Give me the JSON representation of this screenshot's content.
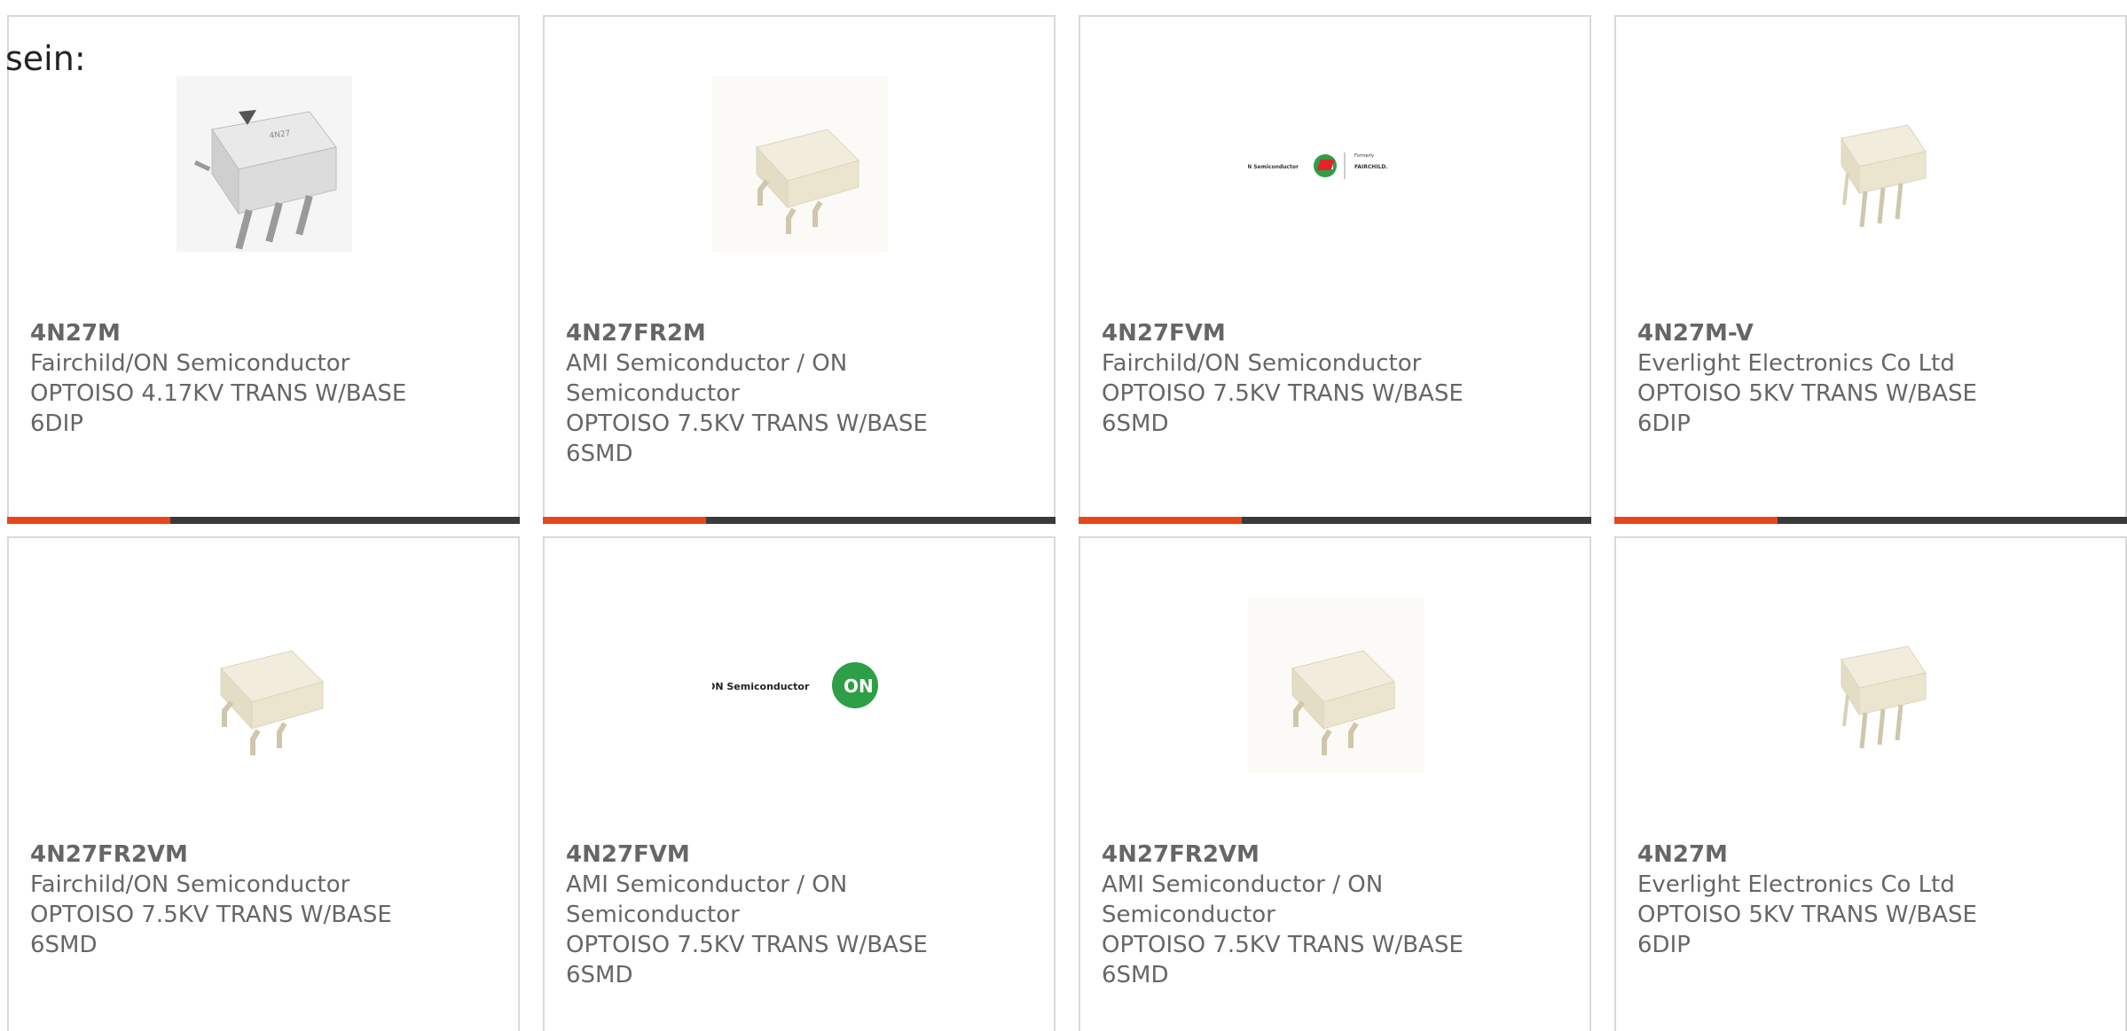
{
  "lead_text": "sein:",
  "colors": {
    "accent": "#e8461b",
    "bar": "#3a3a3a",
    "text": "#666666",
    "border": "#d9d9d9"
  },
  "cards": [
    {
      "part": "4N27M",
      "maker": "Fairchild/ON Semiconductor",
      "desc": "OPTOISO 4.17KV TRANS W/BASE",
      "pkg": "6DIP",
      "image": "white-dip6-optocoupler-photo"
    },
    {
      "part": "4N27FR2M",
      "maker": "AMI Semiconductor / ON Semiconductor",
      "desc": "OPTOISO 7.5KV TRANS W/BASE",
      "pkg": "6SMD",
      "image": "cream-smd6-optocoupler-photo"
    },
    {
      "part": "4N27FVM",
      "maker": "Fairchild/ON Semiconductor",
      "desc": "OPTOISO 7.5KV TRANS W/BASE",
      "pkg": "6SMD",
      "image": "on-semi-formerly-fairchild-logo",
      "logo_text": [
        "ON Semiconductor",
        "ON",
        "Formerly",
        "FAIRCHILD."
      ]
    },
    {
      "part": "4N27M-V",
      "maker": "Everlight Electronics Co Ltd",
      "desc": "OPTOISO 5KV TRANS W/BASE",
      "pkg": "6DIP",
      "image": "cream-dip6-optocoupler-photo"
    },
    {
      "part": "4N27FR2VM",
      "maker": "Fairchild/ON Semiconductor",
      "desc": "OPTOISO 7.5KV TRANS W/BASE",
      "pkg": "6SMD",
      "image": "cream-smd6-optocoupler-photo"
    },
    {
      "part": "4N27FVM",
      "maker": "AMI Semiconductor / ON Semiconductor",
      "desc": "OPTOISO 7.5KV TRANS W/BASE",
      "pkg": "6SMD",
      "image": "on-semiconductor-logo",
      "logo_text": [
        "ON Semiconductor",
        "ON"
      ]
    },
    {
      "part": "4N27FR2VM",
      "maker": "AMI Semiconductor / ON Semiconductor",
      "desc": "OPTOISO 7.5KV TRANS W/BASE",
      "pkg": "6SMD",
      "image": "cream-smd6-optocoupler-photo"
    },
    {
      "part": "4N27M",
      "maker": "Everlight Electronics Co Ltd",
      "desc": "OPTOISO 5KV TRANS W/BASE",
      "pkg": "6DIP",
      "image": "cream-dip6-optocoupler-photo"
    }
  ]
}
